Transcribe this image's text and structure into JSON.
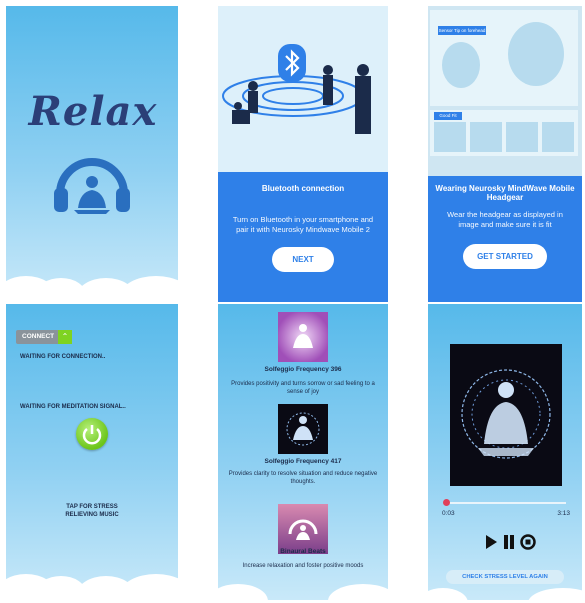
{
  "screens": {
    "splash": {
      "logo_text": "Relax",
      "icon": "headphones-meditation-icon"
    },
    "bluetooth": {
      "title": "Bluetooth connection",
      "body": "Turn on Bluetooth in your smartphone and pair it with Neurosky Mindwave Mobile 2",
      "button": "NEXT",
      "icon": "bluetooth-icon"
    },
    "headgear": {
      "title": "Wearing Neurosky MindWave Mobile Headgear",
      "body": "Wear the headgear as displayed in image and make sure it is fit",
      "button": "GET STARTED",
      "diagram_labels": [
        "Sensor Tip on forehead",
        "Good Fit"
      ]
    },
    "connect": {
      "connect_button": "CONNECT",
      "status_connection": "WAITING FOR CONNECTION..",
      "status_signal": "WAITING FOR MEDITATION SIGNAL..",
      "tap_text": "TAP FOR STRESS RELIEVING MUSIC"
    },
    "music_list": {
      "tracks": [
        {
          "title": "Solfeggio Frequency 396",
          "desc": "Provides positivity and turns sorrow or sad feeling to a sense of joy"
        },
        {
          "title": "Solfeggio Frequency 417",
          "desc": "Provides clarity to resolve situation and reduce negative thoughts."
        },
        {
          "title": "Binaural Beats",
          "desc": "Increase relaxation and foster positive moods"
        }
      ]
    },
    "player": {
      "time_current": "0:03",
      "time_total": "3:13",
      "progress": 0.02,
      "check_button": "CHECK STRESS LEVEL AGAIN"
    }
  },
  "colors": {
    "sky_top": "#56b9ea",
    "accent_blue": "#2f80e8",
    "headphone_blue": "#2a6fbf",
    "power_green": "#7ed321"
  }
}
